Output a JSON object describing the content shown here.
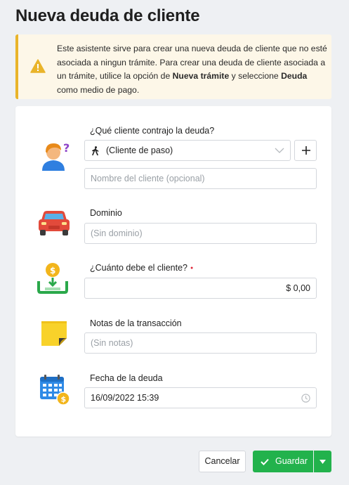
{
  "page": {
    "title": "Nueva deuda de cliente"
  },
  "alert": {
    "icon": "warning-icon",
    "text_before": "Este asistente sirve para crear una nueva deuda de cliente que no esté asociada a ningun trámite. Para crear una deuda de cliente asociada a un trámite, utilice la opción de ",
    "bold_1": "Nueva trámite",
    "text_middle": " y seleccione ",
    "bold_2": "Deuda",
    "text_after": " como medio de pago."
  },
  "form": {
    "client": {
      "label": "¿Qué cliente contrajo la deuda?",
      "selected": "(Cliente de paso)",
      "name_placeholder": "Nombre del cliente (opcional)"
    },
    "domain": {
      "label": "Dominio",
      "placeholder": "(Sin dominio)"
    },
    "amount": {
      "label": "¿Cuánto debe el cliente?",
      "required_mark": "●",
      "value": "$ 0,00"
    },
    "notes": {
      "label": "Notas de la transacción",
      "placeholder": "(Sin notas)"
    },
    "date": {
      "label": "Fecha de la deuda",
      "value": "16/09/2022 15:39"
    }
  },
  "actions": {
    "cancel": "Cancelar",
    "save": "Guardar"
  },
  "colors": {
    "accent_green": "#22b24c",
    "warning": "#e9b42a",
    "required": "#e0283a"
  }
}
